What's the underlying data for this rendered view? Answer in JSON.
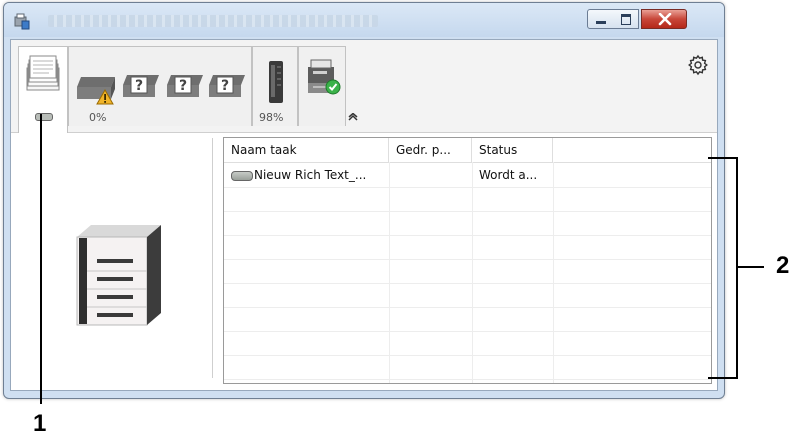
{
  "window": {
    "controls": [
      "minimize",
      "maximize",
      "close"
    ],
    "icons": {
      "app": "printer-app-icon",
      "close": "close-icon"
    }
  },
  "toolbar": {
    "tabs": [
      {
        "id": "jobs",
        "icon": "document-stack-icon",
        "status_icon": "toner-icon"
      },
      {
        "id": "tray",
        "icon": "paper-tray-icon",
        "sub_icons": [
          "warning-icon",
          "unknown-icon",
          "unknown-icon",
          "unknown-icon"
        ],
        "percent": "0%"
      },
      {
        "id": "toner",
        "icon": "toner-cartridge-icon",
        "percent": "98%"
      },
      {
        "id": "device",
        "icon": "device-ok-icon"
      }
    ],
    "collapse_icon": "chevron-up-icon",
    "settings_icon": "gear-icon"
  },
  "left_pane": {
    "image": "printer-image"
  },
  "job_table": {
    "columns": [
      "Naam taak",
      "Gedr. p...",
      "Status"
    ],
    "rows": [
      {
        "name": "Nieuw Rich Text_...",
        "pages": "",
        "status": "Wordt a..."
      }
    ]
  },
  "annotations": {
    "label_1": "1",
    "label_2": "2"
  },
  "colors": {
    "window_frame": "#cfdff1",
    "close_button": "#c8473a",
    "warning": "#f0b429",
    "ok_check": "#3bb24a"
  }
}
